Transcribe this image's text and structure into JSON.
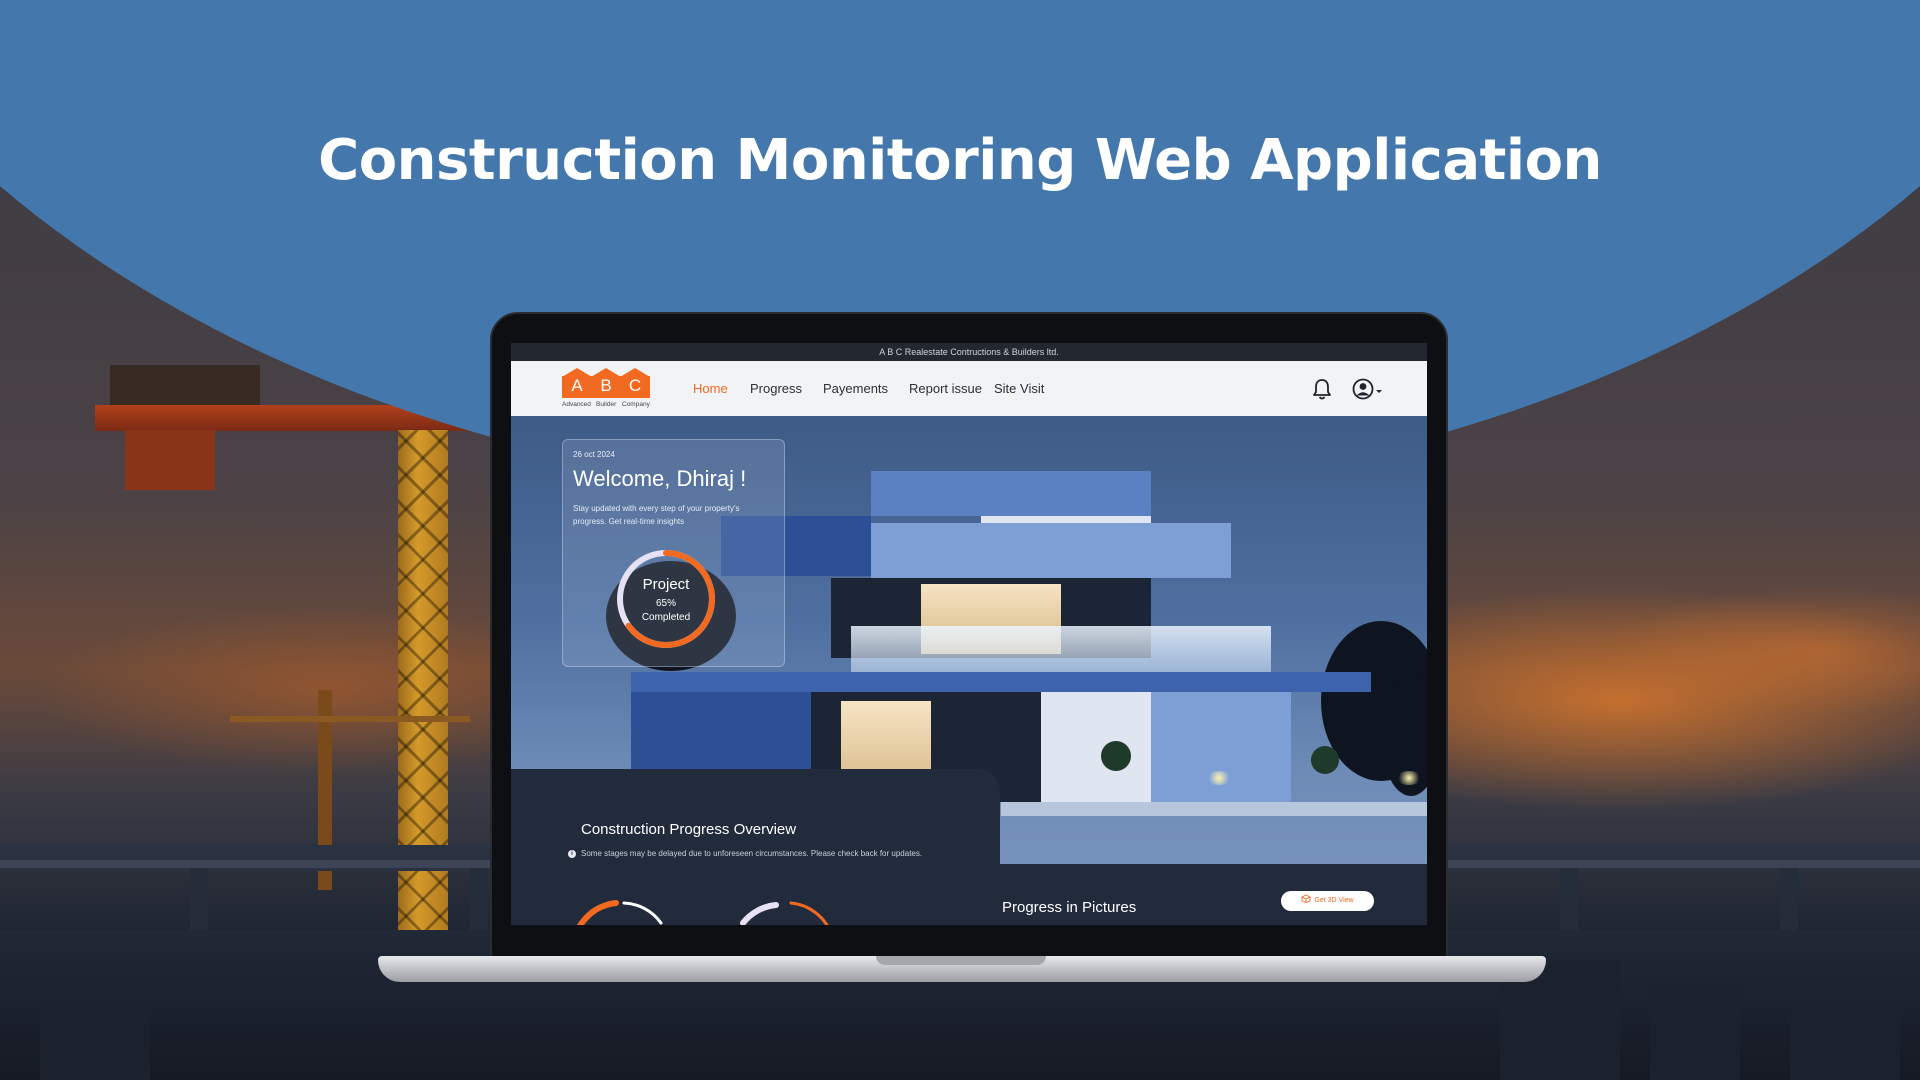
{
  "page": {
    "title": "Construction Monitoring Web Application"
  },
  "app": {
    "company_bar": "A B C Realestate Contructions & Builders ltd.",
    "logo": {
      "letters": [
        "A",
        "B",
        "C"
      ],
      "captions": [
        "Advanced",
        "Builder",
        "Company"
      ],
      "color": "#f26a21"
    },
    "nav": {
      "items": [
        {
          "label": "Home",
          "active": true
        },
        {
          "label": "Progress",
          "active": false
        },
        {
          "label": "Payements",
          "active": false
        },
        {
          "label": "Report issue",
          "active": false
        },
        {
          "label": "Site Visit",
          "active": false
        }
      ],
      "icons": [
        "bell-icon",
        "user-account-icon",
        "caret-down-icon"
      ]
    },
    "welcome": {
      "date": "26 oct 2024",
      "title": "Welcome, Dhiraj !",
      "subtitle": "Stay updated with every step of your property's progress. Get real-time insights",
      "progress": {
        "label": "Project",
        "percent_text": "65%",
        "status": "Completed",
        "value": 0.65
      }
    },
    "overview": {
      "title": "Construction Progress Overview",
      "note": "Some stages may be delayed due to unforeseen circumstances. Please check back for updates."
    },
    "pictures": {
      "title": "Progress in Pictures",
      "button_label": "Get 3D View"
    }
  },
  "colors": {
    "accent": "#f26a21",
    "band": "#4478ac",
    "panel": "#222b3c"
  }
}
